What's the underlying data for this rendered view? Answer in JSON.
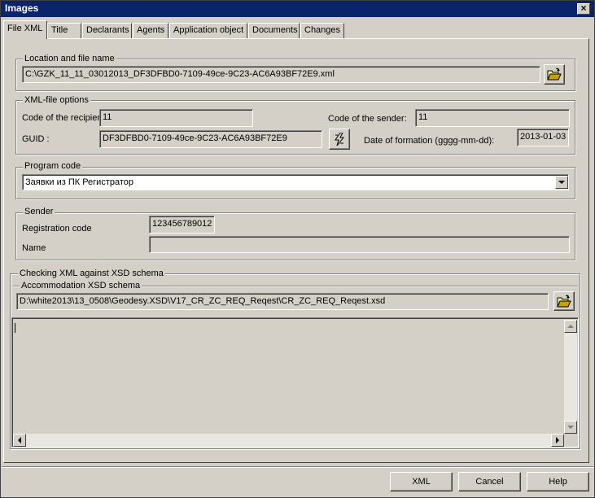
{
  "window": {
    "title": "Images",
    "close_glyph": "×"
  },
  "tabs": [
    {
      "label": "File XML",
      "active": true
    },
    {
      "label": "Title"
    },
    {
      "label": "Declarants"
    },
    {
      "label": "Agents"
    },
    {
      "label": "Application object"
    },
    {
      "label": "Documents"
    },
    {
      "label": "Changes"
    }
  ],
  "location": {
    "legend": "Location and file name",
    "path": "C:\\GZK_11_11_03012013_DF3DFBD0-7109-49ce-9C23-AC6A93BF72E9.xml",
    "browse_icon": "open-folder-icon"
  },
  "xml_options": {
    "legend": "XML-file options",
    "recipient_label": "Code of the recipien",
    "recipient_value": "11",
    "sender_code_label": "Code of the sender:",
    "sender_code_value": "11",
    "guid_label": "GUID :",
    "guid_value": "DF3DFBD0-7109-49ce-9C23-AC6A93BF72E9",
    "guid_button_icon": "lightning-icon",
    "date_label": "Date of formation (gggg-mm-dd):",
    "date_value": "2013-01-03"
  },
  "program": {
    "legend": "Program code",
    "selected": "Заявки из ПК Регистратор"
  },
  "sender": {
    "legend": "Sender",
    "reg_label": "Registration code",
    "reg_value": "123456789012",
    "name_label": "Name",
    "name_value": ""
  },
  "xsd": {
    "legend": "Checking XML against XSD schema",
    "sub_legend": "Accommodation XSD schema",
    "path": "D:\\white2013\\13_0508\\Geodesy.XSD\\V17_CR_ZC_REQ_Reqest\\CR_ZC_REQ_Reqest.xsd",
    "log_text": ""
  },
  "buttons": {
    "xml": "XML",
    "cancel": "Cancel",
    "help": "Help"
  },
  "colors": {
    "title_bar": "#0a246a",
    "face": "#d4d0c8"
  }
}
